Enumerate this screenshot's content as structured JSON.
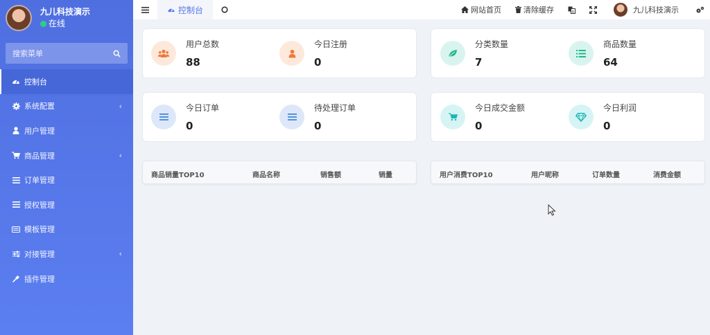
{
  "sidebar": {
    "user": {
      "name": "九儿科技演示",
      "status": "在线"
    },
    "search": {
      "placeholder": "搜索菜单"
    },
    "items": [
      {
        "label": "控制台",
        "icon": "dashboard-icon",
        "active": true,
        "has_submenu": false
      },
      {
        "label": "系统配置",
        "icon": "gear-icon",
        "active": false,
        "has_submenu": true
      },
      {
        "label": "用户管理",
        "icon": "user-icon",
        "active": false,
        "has_submenu": false
      },
      {
        "label": "商品管理",
        "icon": "cart-icon",
        "active": false,
        "has_submenu": true
      },
      {
        "label": "订单管理",
        "icon": "list-icon",
        "active": false,
        "has_submenu": false
      },
      {
        "label": "授权管理",
        "icon": "list-icon",
        "active": false,
        "has_submenu": false
      },
      {
        "label": "模板管理",
        "icon": "keyboard-icon",
        "active": false,
        "has_submenu": false
      },
      {
        "label": "对接管理",
        "icon": "sliders-icon",
        "active": false,
        "has_submenu": true
      },
      {
        "label": "插件管理",
        "icon": "plug-icon",
        "active": false,
        "has_submenu": false
      }
    ]
  },
  "topbar": {
    "tab_label": "控制台",
    "home_label": "网站首页",
    "clear_cache_label": "清除缓存",
    "user_name": "九儿科技演示"
  },
  "stats": [
    {
      "label": "用户总数",
      "value": "88",
      "icon": "users-icon",
      "color": "#f07a3a"
    },
    {
      "label": "今日注册",
      "value": "0",
      "icon": "user-icon",
      "color": "#f07a3a"
    },
    {
      "label": "分类数量",
      "value": "7",
      "icon": "leaf-icon",
      "color": "#20b98a"
    },
    {
      "label": "商品数量",
      "value": "64",
      "icon": "list-icon",
      "color": "#20b98a"
    },
    {
      "label": "今日订单",
      "value": "0",
      "icon": "list-icon",
      "color": "#4a86d8"
    },
    {
      "label": "待处理订单",
      "value": "0",
      "icon": "list-icon",
      "color": "#4a86d8"
    },
    {
      "label": "今日成交金额",
      "value": "0",
      "icon": "cart-icon",
      "color": "#1fb5b5"
    },
    {
      "label": "今日利润",
      "value": "0",
      "icon": "diamond-icon",
      "color": "#1fb5b5"
    }
  ],
  "tables": {
    "products": {
      "headers": [
        "商品销量TOP10",
        "商品名称",
        "销售额",
        "销量"
      ]
    },
    "users": {
      "headers": [
        "用户消费TOP10",
        "用户昵称",
        "订单数量",
        "消费金额"
      ]
    }
  }
}
